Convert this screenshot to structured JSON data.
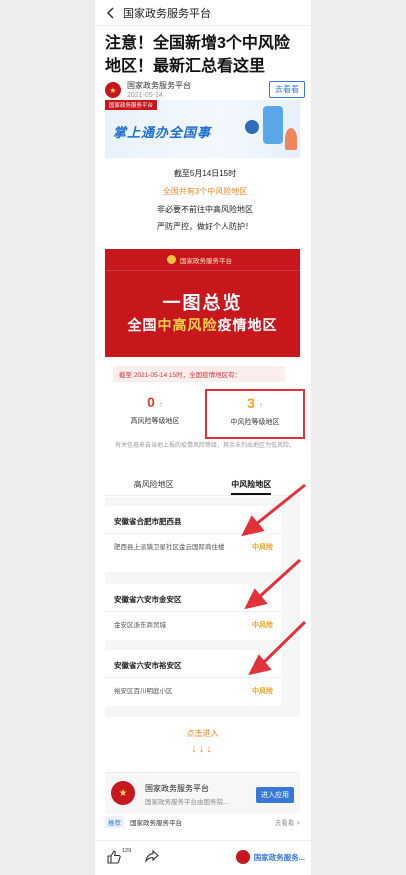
{
  "nav": {
    "back_icon": "chevron-left-icon",
    "title": "国家政务服务平台"
  },
  "article": {
    "headline": "注意！全国新增3个中风险地区！最新汇总看这里",
    "author_name": "国家政务服务平台",
    "date": "2021-05-14",
    "view_button": "去看看"
  },
  "banner": {
    "tag": "国家政务服务平台",
    "slogan": "掌上通办全国事"
  },
  "summary": {
    "line1": "截至5月14日15时",
    "line2": "全国共有3个中风险地区",
    "line3": "非必要不前往中高风险地区",
    "line4": "严防严控，做好个人防护！"
  },
  "poster": {
    "top_label": "国家政务服务平台",
    "title1": "一图总览",
    "title2_a": "全国",
    "title2_hl": "中高风险",
    "title2_b": "疫情地区"
  },
  "stats": {
    "note": "截至 2021-05-14 15时，全国疫情地区有：",
    "high_count": "0",
    "high_label": "高风险等级地区",
    "mid_count": "3",
    "mid_label": "中风险等级地区",
    "arrow_glyph": "↑",
    "disclaimer": "有关信息来自当地上报的疫情风险等级，其余未列出地区为低风险。"
  },
  "tabs": [
    "高风险地区",
    "中风险地区"
  ],
  "areas": [
    {
      "province": "安徽省合肥市肥西县",
      "address": "肥西县上派镇卫星社区金云国际商住楼",
      "level": "中风险"
    },
    {
      "province": "安徽省六安市金安区",
      "address": "金安区浙东商贸城",
      "level": "中风险"
    },
    {
      "province": "安徽省六安市裕安区",
      "address": "裕安区百川明庭小区",
      "level": "中风险"
    }
  ],
  "enter": {
    "text": "点击进入",
    "arrows": "↓↓↓"
  },
  "app": {
    "name": "国家政务服务平台",
    "desc": "国家政务服务平台由国务院...",
    "button": "进入应用"
  },
  "recommend": {
    "tag": "推荐",
    "name": "国家政务服务平台",
    "more": "去看看 >"
  },
  "bottom": {
    "like_count": "129",
    "publisher": "国家政务服务..."
  },
  "colors": {
    "red": "#c8161d",
    "blue": "#3a78d8",
    "orange": "#f0a31f",
    "annotation": "#e3313a"
  }
}
